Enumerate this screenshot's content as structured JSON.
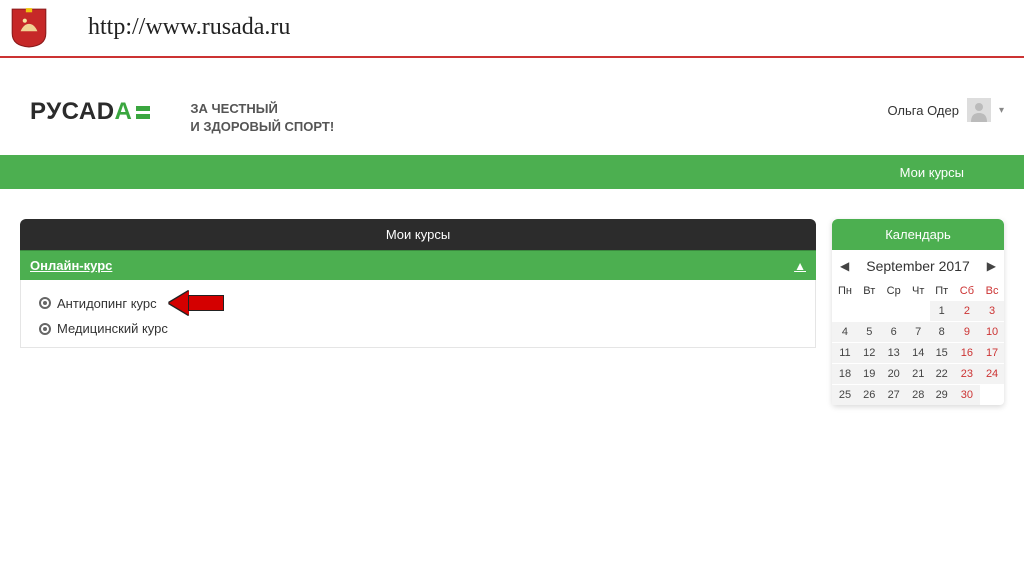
{
  "top": {
    "url": "http://www.rusada.ru"
  },
  "brand": {
    "logo_main": "РУСАD",
    "logo_accent": "A",
    "slogan_line1": "ЗА ЧЕСТНЫЙ",
    "slogan_line2": "И ЗДОРОВЫЙ СПОРТ!"
  },
  "user": {
    "name": "Ольга Одер"
  },
  "navbar": {
    "my_courses": "Мои курсы"
  },
  "courses": {
    "title": "Мои курсы",
    "section_header": "Онлайн-курс",
    "items": [
      {
        "label": "Антидопинг курс",
        "highlighted": true
      },
      {
        "label": "Медицинский курс",
        "highlighted": false
      }
    ]
  },
  "calendar": {
    "title": "Календарь",
    "month": "September 2017",
    "weekdays": [
      "Пн",
      "Вт",
      "Ср",
      "Чт",
      "Пт",
      "Сб",
      "Вс"
    ],
    "weeks": [
      [
        "",
        "",
        "",
        "",
        "1",
        "2",
        "3"
      ],
      [
        "4",
        "5",
        "6",
        "7",
        "8",
        "9",
        "10"
      ],
      [
        "11",
        "12",
        "13",
        "14",
        "15",
        "16",
        "17"
      ],
      [
        "18",
        "19",
        "20",
        "21",
        "22",
        "23",
        "24"
      ],
      [
        "25",
        "26",
        "27",
        "28",
        "29",
        "30",
        ""
      ]
    ]
  },
  "colors": {
    "green": "#4caf50",
    "red": "#c33",
    "arrow": "#d40000"
  }
}
